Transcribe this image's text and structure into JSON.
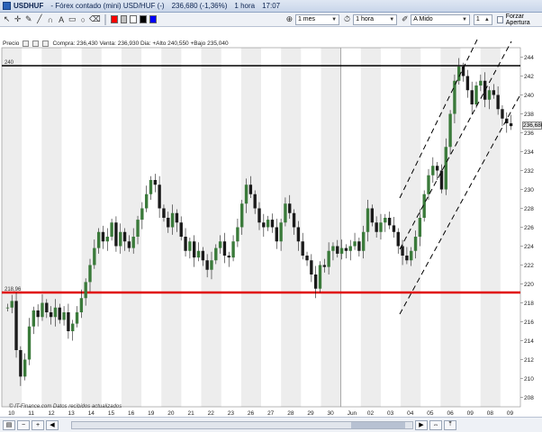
{
  "title": {
    "symbol": "USDHUF",
    "description": "- Fórex contado (mini) USD/HUF (-)",
    "price": "236,680 (-1,36%)",
    "interval": "1 hora",
    "time": "17:07"
  },
  "toolbar": {
    "tools": [
      "pointer-icon",
      "crosshair-icon",
      "pencil-icon",
      "line-icon",
      "magnet-icon",
      "text-icon",
      "ruler-icon",
      "shapes-icon",
      "eraser-icon"
    ],
    "colors": [
      "#ff0000",
      "#c0c0c0",
      "#ffffff",
      "#000000",
      "#0000ff"
    ],
    "period_select": "1 mes",
    "interval_select": "1 hora",
    "drawing_select": "A Mido",
    "count_select": "1",
    "force_open_label": "Forzar Apertura"
  },
  "infobar": {
    "price_label": "Precio",
    "quote": "Compra: 236,430  Venta: 236,930  Dia: +Alto 240,550 +Bajo 235,040"
  },
  "chart_data": {
    "type": "candlestick",
    "y_ticks": [
      208,
      210,
      212,
      214,
      216,
      218,
      220,
      222,
      224,
      226,
      228,
      230,
      232,
      234,
      236,
      238,
      240,
      242,
      244
    ],
    "x_ticks": [
      "10",
      "11",
      "12",
      "13",
      "14",
      "15",
      "16",
      "19",
      "20",
      "21",
      "22",
      "23",
      "26",
      "27",
      "28",
      "29",
      "30",
      "Jun",
      "02",
      "03",
      "04",
      "05",
      "06",
      "09",
      "08",
      "09"
    ],
    "ylim": [
      207,
      245
    ],
    "horizontal_lines": [
      {
        "value": 243.1,
        "label": "240",
        "color": "#000000"
      },
      {
        "value": 219.1,
        "label": "218,96",
        "color": "#e00000"
      }
    ],
    "channel_lines": [
      {
        "x1": 444,
        "y1": 220,
        "x2": 530,
        "y2": 44
      },
      {
        "x1": 444,
        "y1": 277,
        "x2": 568,
        "y2": 46
      },
      {
        "x1": 444,
        "y1": 349,
        "x2": 578,
        "y2": 105
      }
    ],
    "last_price": "236,680",
    "closes": [
      217.5,
      218.2,
      213.0,
      210.2,
      212.0,
      215.5,
      217.2,
      216.5,
      218.0,
      217.0,
      216.5,
      217.5,
      216.2,
      217.0,
      215.0,
      215.8,
      217.0,
      218.5,
      220.2,
      222.0,
      223.8,
      225.5,
      224.5,
      225.0,
      226.5,
      224.0,
      225.5,
      224.5,
      223.8,
      225.0,
      226.8,
      228.0,
      229.5,
      231.0,
      230.5,
      228.0,
      227.0,
      226.0,
      227.5,
      226.5,
      225.0,
      223.5,
      224.5,
      222.8,
      223.5,
      222.5,
      221.5,
      222.5,
      223.8,
      224.5,
      223.0,
      222.8,
      224.5,
      226.0,
      228.5,
      230.5,
      229.5,
      228.0,
      226.5,
      226.0,
      226.8,
      226.0,
      224.5,
      226.5,
      228.5,
      227.5,
      226.0,
      224.5,
      223.0,
      222.5,
      221.0,
      219.5,
      222.0,
      221.8,
      223.5,
      224.0,
      223.2,
      223.8,
      223.5,
      224.0,
      224.5,
      223.5,
      225.5,
      228.0,
      226.5,
      225.5,
      226.5,
      227.0,
      226.2,
      225.5,
      224.0,
      223.0,
      222.5,
      223.5,
      225.0,
      227.0,
      229.5,
      231.5,
      232.5,
      232.0,
      230.0,
      234.5,
      238.0,
      241.5,
      243.0,
      242.0,
      240.5,
      239.0,
      241.0,
      241.5,
      239.5,
      240.5,
      240.0,
      238.5,
      237.5,
      237.0,
      236.7
    ]
  },
  "footer": {
    "credit": "© IT-Finance.com  Datos recibidos actualizados"
  }
}
